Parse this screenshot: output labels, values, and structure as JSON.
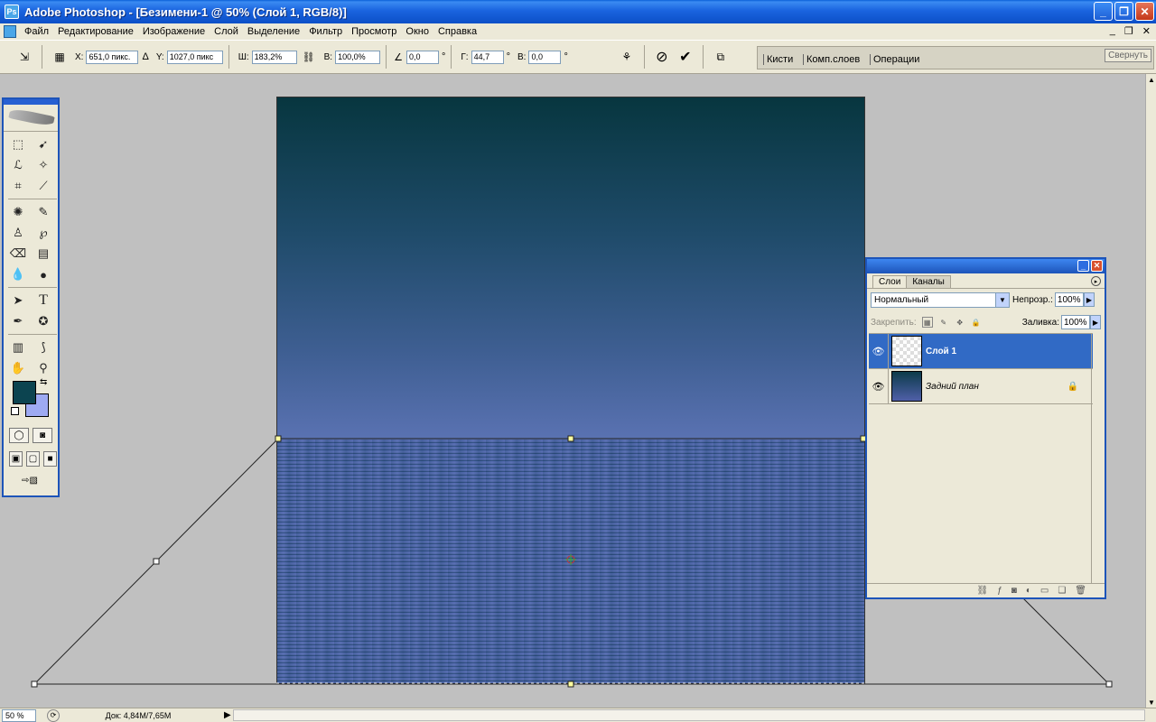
{
  "window": {
    "title": "Adobe Photoshop - [Безимени-1 @ 50% (Слой 1, RGB/8)]",
    "app_icon_text": "Ps",
    "minimize": "_",
    "maximize": "❐",
    "close": "✕"
  },
  "menu": {
    "items": [
      "Файл",
      "Редактирование",
      "Изображение",
      "Слой",
      "Выделение",
      "Фильтр",
      "Просмотр",
      "Окно",
      "Справка"
    ],
    "mdi_minimize": "_",
    "mdi_restore": "❐",
    "mdi_close": "✕"
  },
  "options": {
    "x_label": "X:",
    "x_value": "651,0 пикс.",
    "delta_symbol": "Δ",
    "y_label": "Y:",
    "y_value": "1027,0 пикс",
    "w_label": "Ш:",
    "w_value": "183,2%",
    "h_label": "В:",
    "h_value": "100,0%",
    "angle_value": "0,0",
    "degree": "°",
    "hskew_label": "Г:",
    "hskew_value": "44,7",
    "vskew_label": "В:",
    "vskew_value": "0,0",
    "cancel_symbol": "⃠",
    "commit_symbol": "✔"
  },
  "palette_well": {
    "tabs": [
      "Кисти",
      "Комп.слоев",
      "Операции"
    ],
    "collapse_label": "Свернуть"
  },
  "colors": {
    "foreground": "#0c4450",
    "background": "#9eaaf2",
    "titlebar": "#0c4fc7",
    "selected_layer": "#316ac5"
  },
  "layers_panel": {
    "tabs": [
      "Слои",
      "Каналы"
    ],
    "blend_mode": "Нормальный",
    "opacity_label": "Непрозр.:",
    "opacity_value": "100%",
    "lock_label": "Закрепить:",
    "fill_label": "Заливка:",
    "fill_value": "100%",
    "layers": [
      {
        "name": "Слой 1",
        "selected": true,
        "visible": true,
        "locked": false
      },
      {
        "name": "Задний план",
        "selected": false,
        "visible": true,
        "locked": true
      }
    ]
  },
  "status": {
    "zoom": "50 %",
    "doc_info": "Док: 4,84M/7,65M"
  }
}
